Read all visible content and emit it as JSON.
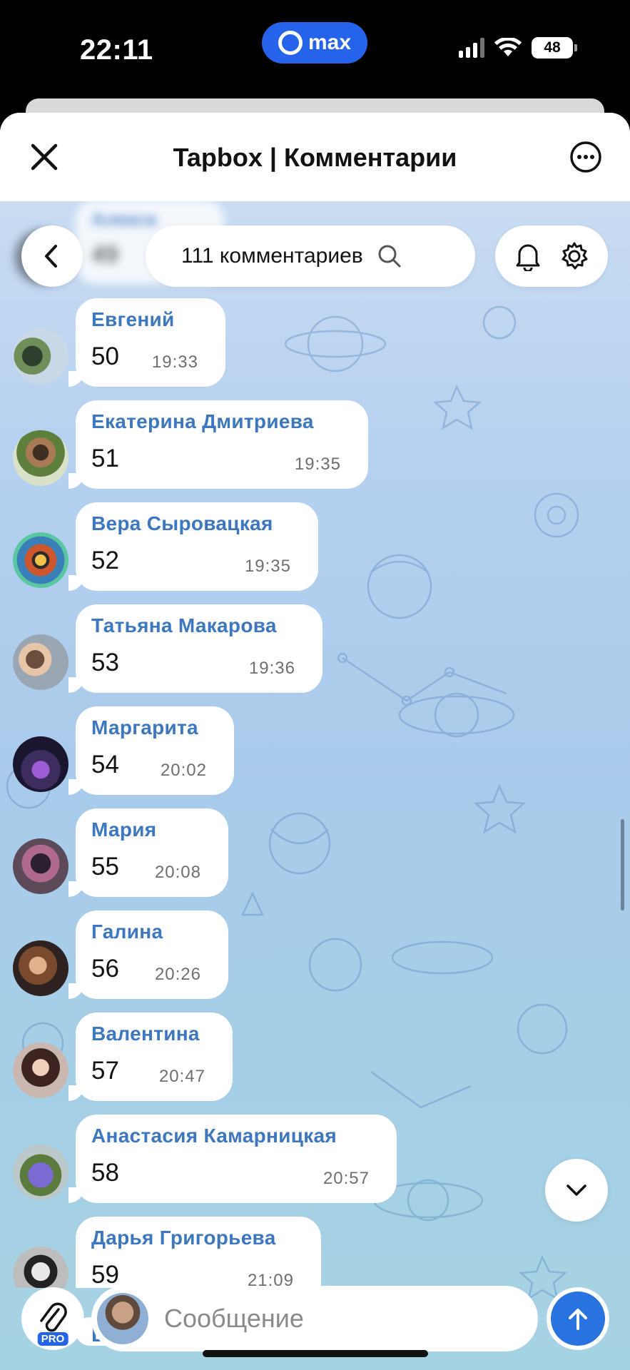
{
  "status_bar": {
    "time": "22:11",
    "app_pill": "max",
    "battery": "48"
  },
  "header": {
    "title": "Tapbox | Комментарии"
  },
  "toolbar": {
    "comment_count": "111 комментариев"
  },
  "previous_message": {
    "author": "Алекса",
    "text": "49"
  },
  "messages": [
    {
      "author": "Евгений",
      "text": "50",
      "time": "19:33"
    },
    {
      "author": "Екатерина Дмитриева",
      "text": "51",
      "time": "19:35"
    },
    {
      "author": "Вера Сыровацкая",
      "text": "52",
      "time": "19:35"
    },
    {
      "author": "Татьяна Макарова",
      "text": "53",
      "time": "19:36"
    },
    {
      "author": "Маргарита",
      "text": "54",
      "time": "20:02"
    },
    {
      "author": "Мария",
      "text": "55",
      "time": "20:08"
    },
    {
      "author": "Галина",
      "text": "56",
      "time": "20:26"
    },
    {
      "author": "Валентина",
      "text": "57",
      "time": "20:47"
    },
    {
      "author": "Анастасия Камарницкая",
      "text": "58",
      "time": "20:57"
    },
    {
      "author": "Дарья Григорьева",
      "text": "59",
      "time": "21:09"
    }
  ],
  "composer": {
    "placeholder": "Сообщение",
    "pro_badge": "PRO"
  },
  "colors": {
    "accent": "#2873e0",
    "author_name": "#3d77c0"
  },
  "icons": [
    "close-icon",
    "more-icon",
    "back-icon",
    "search-icon",
    "bell-icon",
    "gear-icon",
    "chevron-down-icon",
    "paperclip-icon",
    "send-arrow-icon"
  ]
}
